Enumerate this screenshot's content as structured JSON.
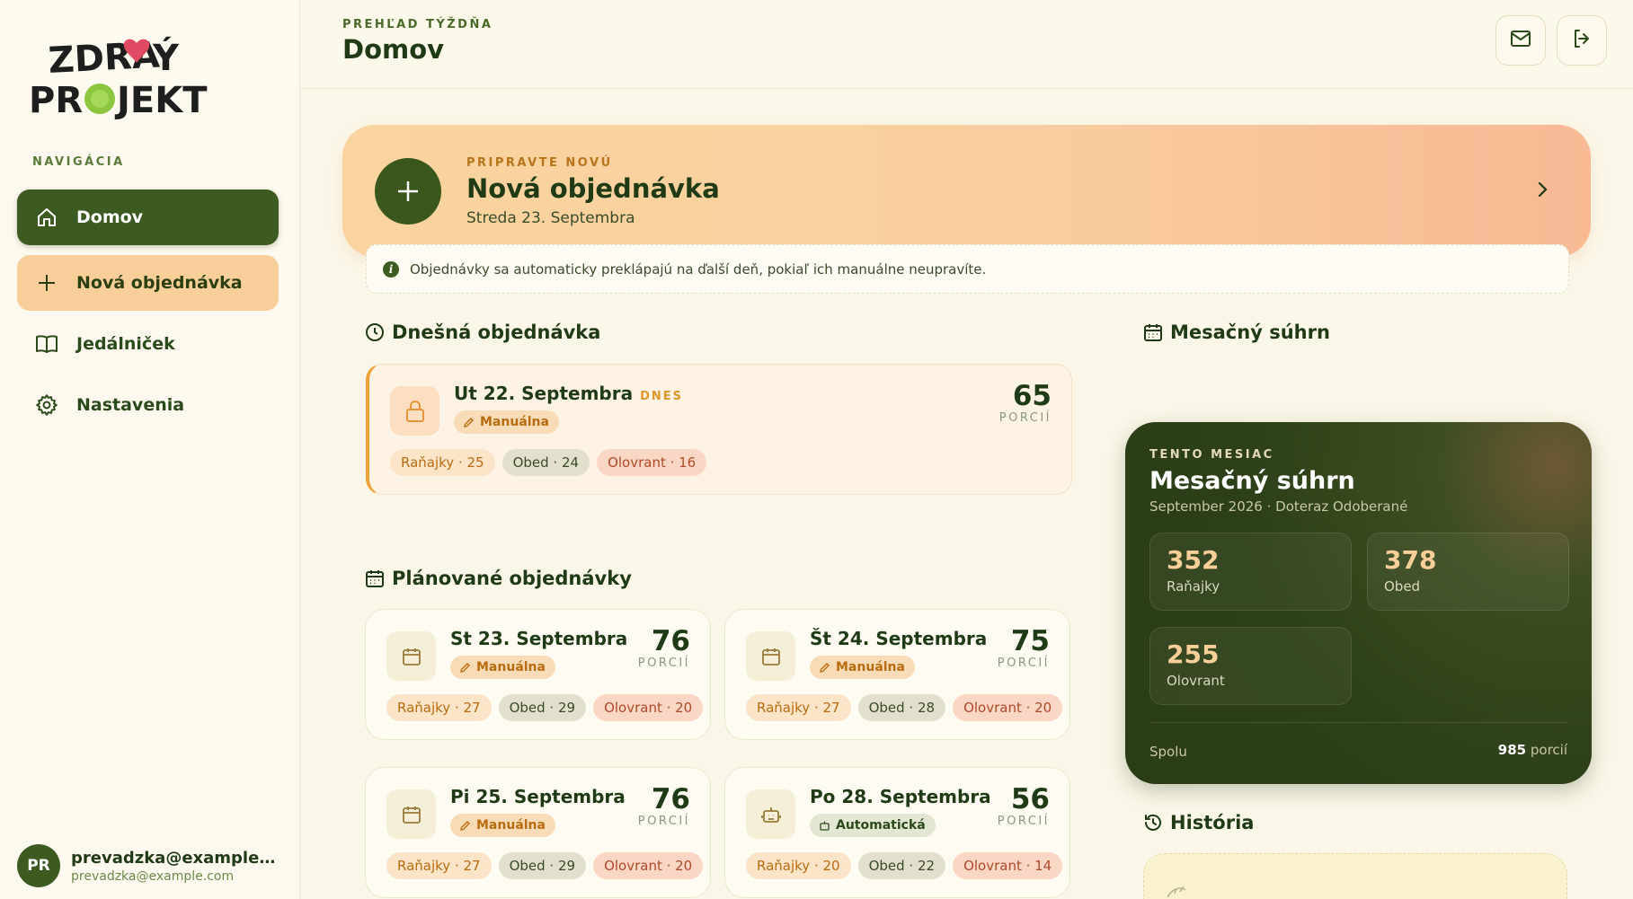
{
  "sidebar": {
    "nav_heading": "NAVIGÁCIA",
    "items": [
      {
        "label": "Domov",
        "icon": "home-icon",
        "state": "active"
      },
      {
        "label": "Nová objednávka",
        "icon": "plus-icon",
        "state": "accent"
      },
      {
        "label": "Jedálniček",
        "icon": "book-icon",
        "state": "default"
      },
      {
        "label": "Nastavenia",
        "icon": "gear-icon",
        "state": "default"
      }
    ],
    "user": {
      "initials": "PR",
      "name": "prevadzka@example.co...",
      "email": "prevadzka@example.com"
    }
  },
  "header": {
    "kicker": "PREHĽAD TÝŽDŇA",
    "title": "Domov",
    "buttons": [
      "mail-icon",
      "logout-icon"
    ]
  },
  "banner": {
    "kicker": "PRIPRAVTE NOVÚ",
    "title": "Nová objednávka",
    "date": "Streda 23. Septembra",
    "notice": "Objednávky sa automaticky preklápajú na ďalší deň, pokiaľ ich manuálne neupravíte."
  },
  "today_section": {
    "title": "Dnešná objednávka",
    "card": {
      "date": "Ut 22. Septembra",
      "badge": "DNES",
      "mode": "Manuálna",
      "portions": "65",
      "portions_label": "PORCIÍ",
      "breakfast": "Raňajky · 25",
      "lunch": "Obed · 24",
      "snack": "Olovrant · 16"
    }
  },
  "planned_section": {
    "title": "Plánované objednávky",
    "cards": [
      {
        "date": "St 23. Septembra",
        "mode": "Manuálna",
        "portions": "76",
        "portions_label": "PORCIÍ",
        "breakfast": "Raňajky · 27",
        "lunch": "Obed · 29",
        "snack": "Olovrant · 20"
      },
      {
        "date": "Št 24. Septembra",
        "mode": "Manuálna",
        "portions": "75",
        "portions_label": "PORCIÍ",
        "breakfast": "Raňajky · 27",
        "lunch": "Obed · 28",
        "snack": "Olovrant · 20"
      },
      {
        "date": "Pi 25. Septembra",
        "mode": "Manuálna",
        "portions": "76",
        "portions_label": "PORCIÍ",
        "breakfast": "Raňajky · 27",
        "lunch": "Obed · 29",
        "snack": "Olovrant · 20"
      },
      {
        "date": "Po 28. Septembra",
        "mode": "Automatická",
        "portions": "56",
        "portions_label": "PORCIÍ",
        "breakfast": "Raňajky · 20",
        "lunch": "Obed · 22",
        "snack": "Olovrant · 14"
      }
    ]
  },
  "monthly": {
    "section_title": "Mesačný súhrn",
    "kicker": "TENTO MESIAC",
    "title": "Mesačný súhrn",
    "subtitle": "September 2026 · Doteraz Odoberané",
    "stats": [
      {
        "value": "352",
        "label": "Raňajky"
      },
      {
        "value": "378",
        "label": "Obed"
      },
      {
        "value": "255",
        "label": "Olovrant"
      }
    ],
    "total_label": "Spolu",
    "total_value": "985",
    "total_unit": "porcií"
  },
  "history": {
    "title": "História"
  },
  "colors": {
    "primary_green": "#3d5a20",
    "accent_peach": "#f8cf98",
    "background": "#fbf7e8"
  }
}
